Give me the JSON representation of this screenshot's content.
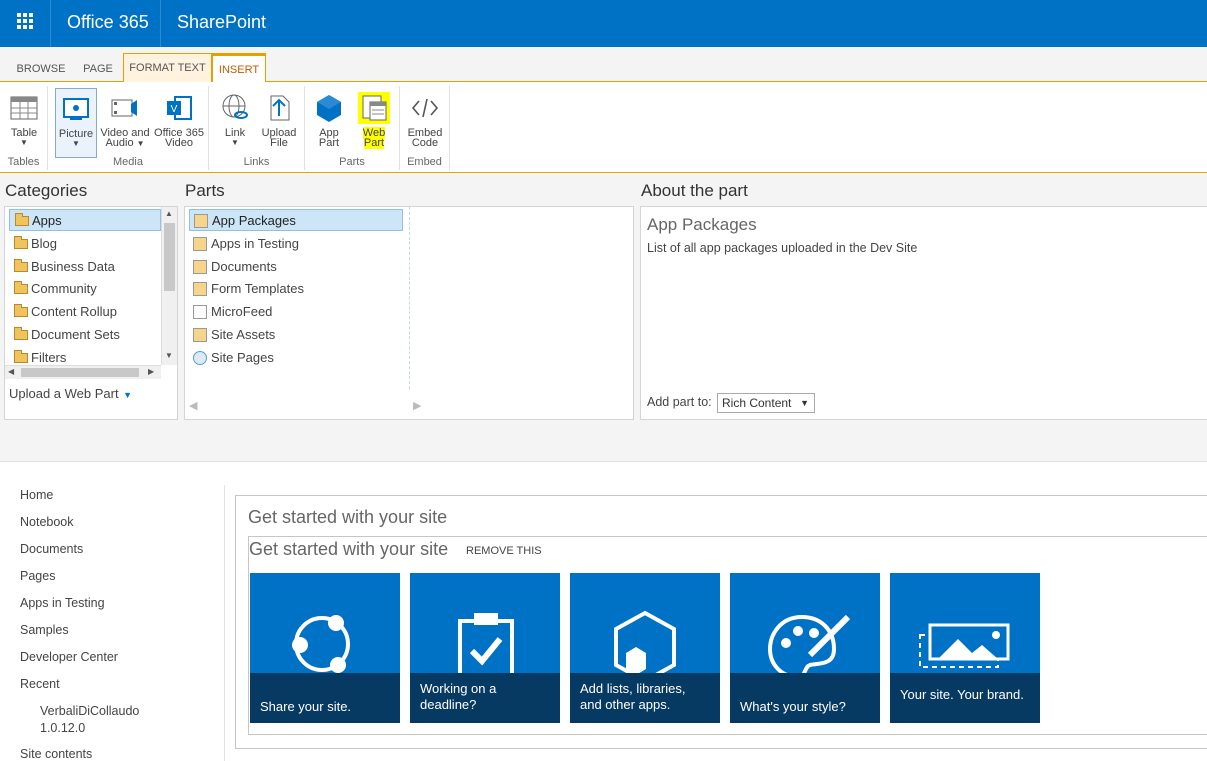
{
  "suite": {
    "app": "Office 365",
    "site": "SharePoint",
    "color": "#0072c6"
  },
  "ribbon": {
    "tabs": [
      "BROWSE",
      "PAGE",
      "FORMAT TEXT",
      "INSERT"
    ],
    "groups": {
      "tables": {
        "label": "Tables",
        "table": "Table"
      },
      "media": {
        "label": "Media",
        "picture": "Picture",
        "video_audio_1": "Video and",
        "video_audio_2": "Audio",
        "o365_video_1": "Office 365",
        "o365_video_2": "Video"
      },
      "links": {
        "label": "Links",
        "link": "Link",
        "upload_1": "Upload",
        "upload_2": "File"
      },
      "parts": {
        "label": "Parts",
        "app_part_1": "App",
        "app_part_2": "Part",
        "web_part_1": "Web",
        "web_part_2": "Part"
      },
      "embed": {
        "label": "Embed",
        "embed_1": "Embed",
        "embed_2": "Code"
      }
    }
  },
  "adder": {
    "categories_title": "Categories",
    "parts_title": "Parts",
    "about_title": "About the part",
    "categories": [
      "Apps",
      "Blog",
      "Business Data",
      "Community",
      "Content Rollup",
      "Document Sets",
      "Filters"
    ],
    "parts": [
      "App Packages",
      "Apps in Testing",
      "Documents",
      "Form Templates",
      "MicroFeed",
      "Site Assets",
      "Site Pages"
    ],
    "upload_link": "Upload a Web Part",
    "about": {
      "name": "App Packages",
      "description": "List of all app packages uploaded in the Dev Site",
      "add_to_label": "Add part to:",
      "add_to_value": "Rich Content"
    }
  },
  "nav": [
    "Home",
    "Notebook",
    "Documents",
    "Pages",
    "Apps in Testing",
    "Samples",
    "Developer Center",
    "Recent",
    "VerbaliDiCollaudo",
    "1.0.12.0",
    "Site contents"
  ],
  "content": {
    "zone_title": "Get started with your site",
    "inner_title": "Get started with your site",
    "remove": "REMOVE THIS",
    "tiles": [
      {
        "caption": "Share your site."
      },
      {
        "caption": "Working on a deadline?"
      },
      {
        "caption": "Add lists, libraries, and other apps."
      },
      {
        "caption": "What's your style?"
      },
      {
        "caption": "Your site. Your brand."
      }
    ]
  }
}
